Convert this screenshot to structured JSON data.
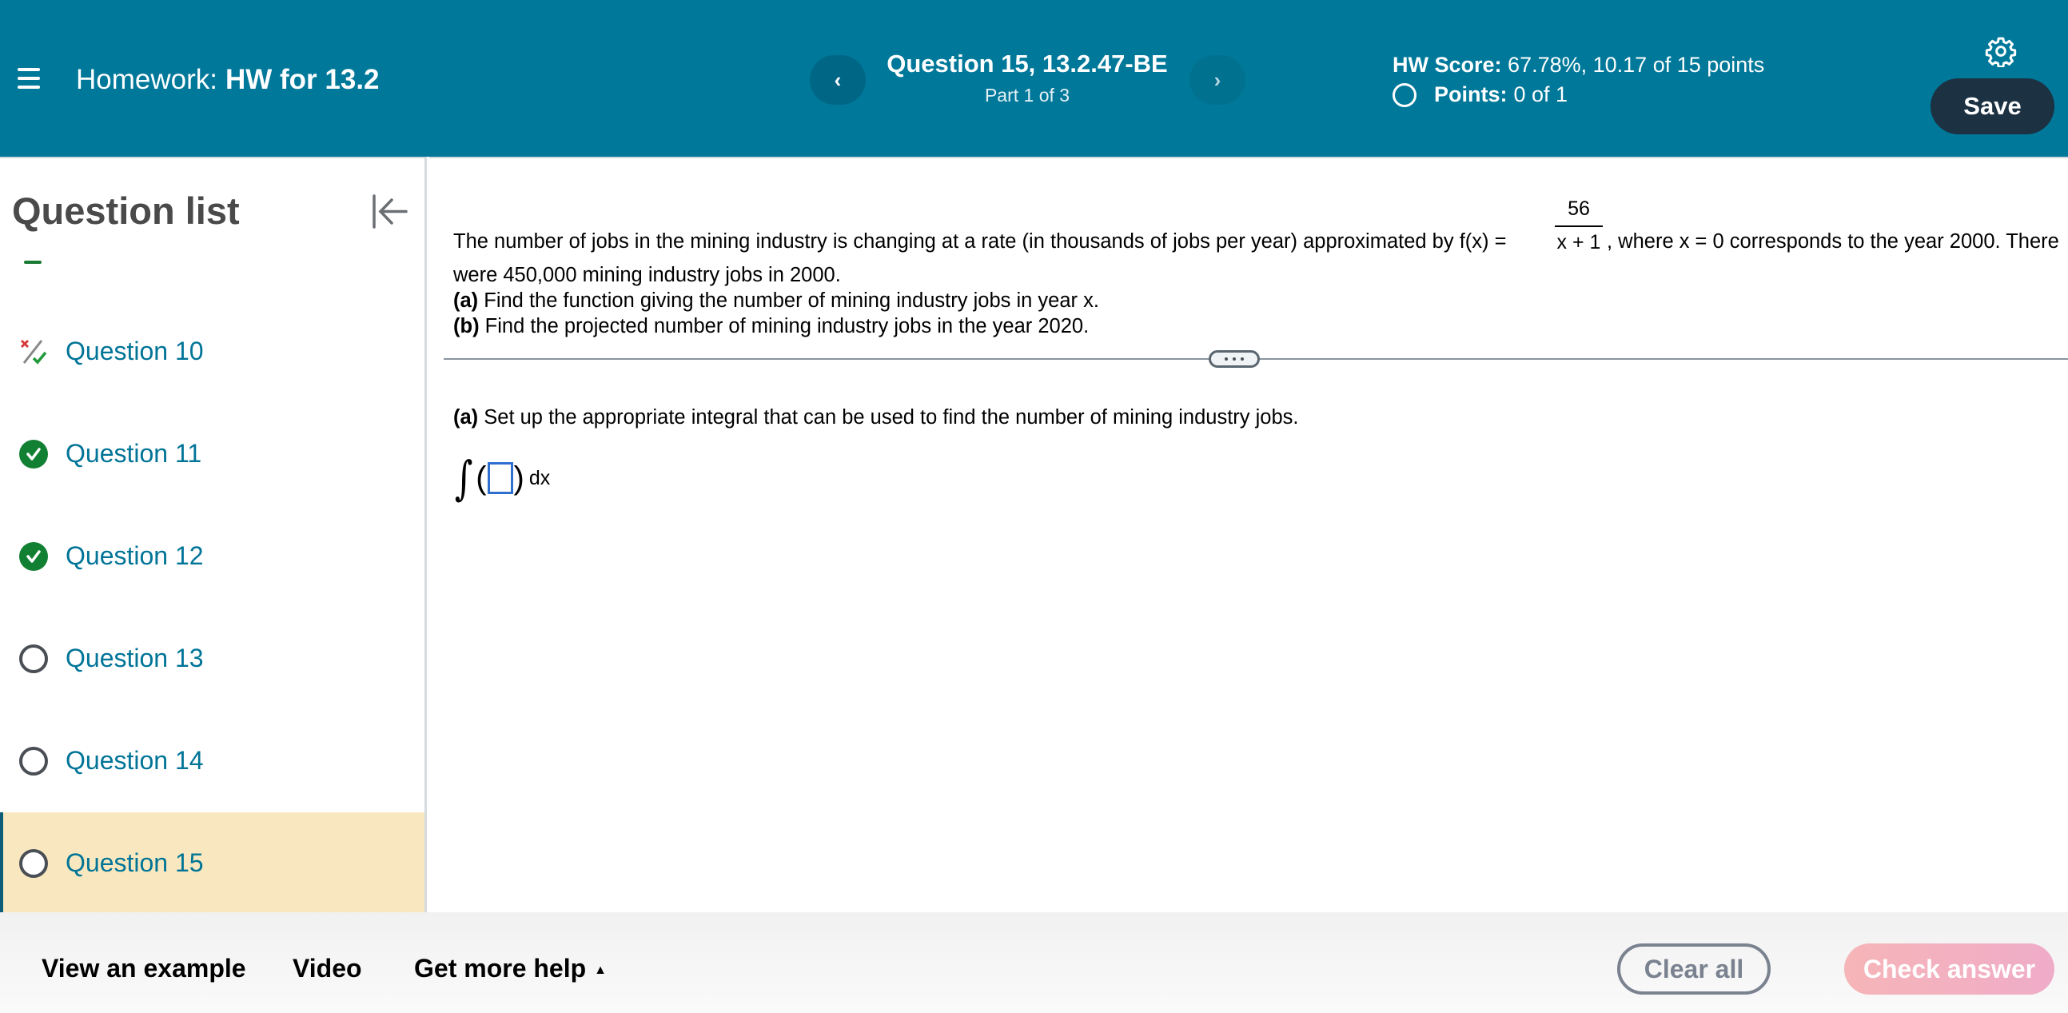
{
  "header": {
    "homework_label": "Homework:",
    "homework_name": "HW for 13.2",
    "question_title": "Question 15, 13.2.47-BE",
    "part_label": "Part 1 of 3",
    "prev_label": "‹",
    "next_label": "›",
    "hw_score_label": "HW Score:",
    "hw_score_value": "67.78%, 10.17 of 15 points",
    "points_label": "Points:",
    "points_value": "0 of 1",
    "save_label": "Save",
    "colors": {
      "bar": "#00789a",
      "save_bg": "#1c3142"
    }
  },
  "sidebar": {
    "title": "Question list",
    "items": [
      {
        "label": "Question 10",
        "status": "partial",
        "icon": "partial-credit-icon"
      },
      {
        "label": "Question 11",
        "status": "correct",
        "icon": "check-circle-icon"
      },
      {
        "label": "Question 12",
        "status": "correct",
        "icon": "check-circle-icon"
      },
      {
        "label": "Question 13",
        "status": "unanswered",
        "icon": "empty-circle-icon"
      },
      {
        "label": "Question 14",
        "status": "unanswered",
        "icon": "empty-circle-icon"
      },
      {
        "label": "Question 15",
        "status": "unanswered",
        "icon": "empty-circle-icon",
        "active": true
      }
    ]
  },
  "question": {
    "intro_pre": "The number of jobs in the mining industry is changing at a rate (in thousands of jobs per year) approximated by f(x) =",
    "fraction_numerator": "56",
    "fraction_denominator": "x + 1",
    "intro_post": ", where x = 0 corresponds to the year 2000. There",
    "line2": "were 450,000 mining industry jobs in 2000.",
    "part_a_tag": "(a)",
    "part_a_text": " Find the function giving the number of mining industry jobs in year x.",
    "part_b_tag": "(b)",
    "part_b_text": " Find the projected number of mining industry jobs in the year 2020."
  },
  "answer_area": {
    "instruction_tag": "(a)",
    "instruction_text": " Set up the appropriate integral that can be used to find the number of mining industry jobs.",
    "integral_sign": "∫",
    "open_paren": "(",
    "close_paren": ")",
    "differential": "dx",
    "answer_value": ""
  },
  "footer": {
    "view_example": "View an example",
    "video": "Video",
    "more_help": "Get more help",
    "more_help_arrow": "▲",
    "clear_all": "Clear all",
    "check_answer": "Check answer"
  }
}
